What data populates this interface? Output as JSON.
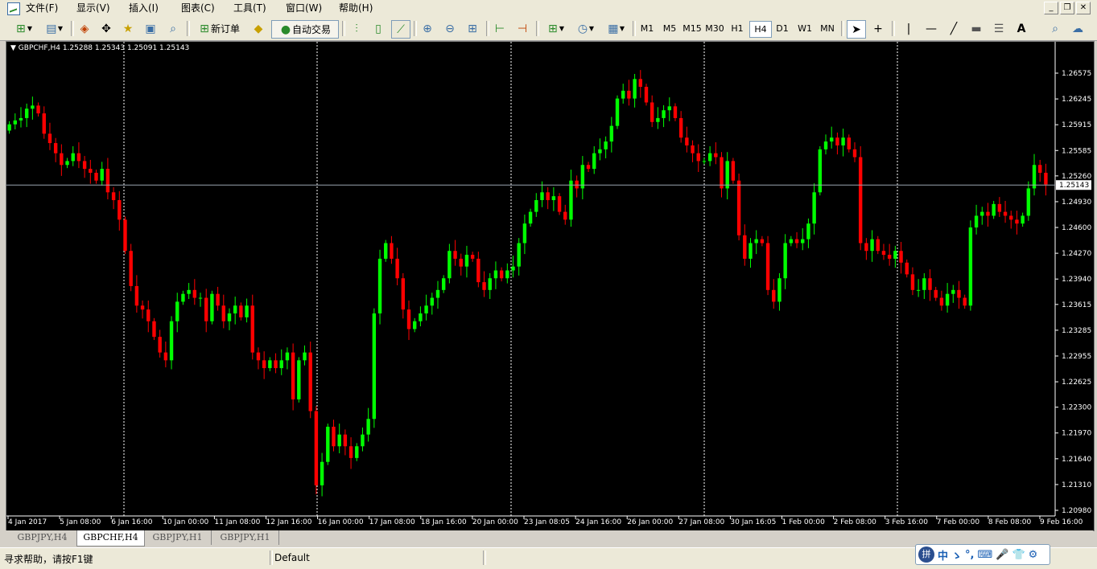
{
  "menu": [
    "文件(F)",
    "显示(V)",
    "插入(I)",
    "图表(C)",
    "工具(T)",
    "窗口(W)",
    "帮助(H)"
  ],
  "window_controls": [
    "_",
    "❐",
    "✕"
  ],
  "toolbar": {
    "new_order_label": "新订单",
    "auto_trade_label": "自动交易",
    "timeframes": [
      "M1",
      "M5",
      "M15",
      "M30",
      "H1",
      "H4",
      "D1",
      "W1",
      "MN"
    ],
    "active_timeframe": "H4",
    "crosshair_label": "+",
    "text_label": "A",
    "line_label": "|"
  },
  "chart": {
    "header": "GBPCHF,H4  1.25288 1.25343 1.25091 1.25143",
    "current_price": "1.25143",
    "bull_color": "#00ff00",
    "bear_color": "#ff0000",
    "grid_color": "#ffffff",
    "price_line_color": "#9aa3b0"
  },
  "chart_data": {
    "type": "candlestick",
    "symbol": "GBPCHF",
    "timeframe": "H4",
    "ylim": [
      1.2098,
      1.2675
    ],
    "y_ticks": [
      "1.26575",
      "1.26245",
      "1.25915",
      "1.25585",
      "1.25260",
      "1.24930",
      "1.24600",
      "1.24270",
      "1.23940",
      "1.23615",
      "1.23285",
      "1.22955",
      "1.22625",
      "1.22300",
      "1.21970",
      "1.21640",
      "1.21310",
      "1.20980"
    ],
    "x_ticks": [
      "4 Jan 2017",
      "5 Jan 08:00",
      "6 Jan 16:00",
      "10 Jan 00:00",
      "11 Jan 08:00",
      "12 Jan 16:00",
      "16 Jan 00:00",
      "17 Jan 08:00",
      "18 Jan 16:00",
      "20 Jan 00:00",
      "23 Jan 08:05",
      "24 Jan 16:00",
      "26 Jan 00:00",
      "27 Jan 08:00",
      "30 Jan 16:05",
      "1 Feb 00:00",
      "2 Feb 08:00",
      "3 Feb 16:00",
      "7 Feb 00:00",
      "8 Feb 08:00",
      "9 Feb 16:00"
    ],
    "closes": [
      1.2592,
      1.2597,
      1.26,
      1.2612,
      1.2616,
      1.2606,
      1.258,
      1.2568,
      1.2555,
      1.254,
      1.2545,
      1.2555,
      1.2545,
      1.2535,
      1.253,
      1.252,
      1.2535,
      1.2505,
      1.2495,
      1.247,
      1.243,
      1.2385,
      1.236,
      1.2355,
      1.234,
      1.232,
      1.23,
      1.229,
      1.234,
      1.2365,
      1.2375,
      1.238,
      1.237,
      1.237,
      1.234,
      1.2375,
      1.236,
      1.234,
      1.235,
      1.236,
      1.2345,
      1.236,
      1.23,
      1.229,
      1.228,
      1.229,
      1.228,
      1.229,
      1.23,
      1.224,
      1.229,
      1.23,
      1.2225,
      1.213,
      1.216,
      1.2205,
      1.218,
      1.2195,
      1.218,
      1.2165,
      1.218,
      1.2195,
      1.2215,
      1.235,
      1.242,
      1.244,
      1.242,
      1.2395,
      1.2355,
      1.233,
      1.234,
      1.235,
      1.236,
      1.237,
      1.238,
      1.2395,
      1.243,
      1.242,
      1.241,
      1.2425,
      1.242,
      1.239,
      1.238,
      1.2395,
      1.2405,
      1.2395,
      1.2405,
      1.241,
      1.244,
      1.2465,
      1.248,
      1.2495,
      1.2505,
      1.2495,
      1.25,
      1.248,
      1.247,
      1.252,
      1.251,
      1.254,
      1.2535,
      1.2555,
      1.256,
      1.257,
      1.259,
      1.2625,
      1.2635,
      1.2625,
      1.265,
      1.264,
      1.262,
      1.2595,
      1.26,
      1.261,
      1.2615,
      1.26,
      1.2575,
      1.2565,
      1.2555,
      1.2545,
      1.2545,
      1.2555,
      1.255,
      1.251,
      1.2545,
      1.252,
      1.245,
      1.242,
      1.244,
      1.2445,
      1.244,
      1.238,
      1.2365,
      1.2395,
      1.244,
      1.2445,
      1.244,
      1.2445,
      1.2465,
      1.2505,
      1.256,
      1.257,
      1.2575,
      1.2565,
      1.2575,
      1.256,
      1.255,
      1.244,
      1.243,
      1.2445,
      1.243,
      1.2425,
      1.242,
      1.243,
      1.2415,
      1.24,
      1.238,
      1.238,
      1.2395,
      1.238,
      1.237,
      1.236,
      1.2375,
      1.238,
      1.237,
      1.236,
      1.246,
      1.2475,
      1.248,
      1.2475,
      1.249,
      1.248,
      1.2475,
      1.247,
      1.2465,
      1.2475,
      1.251,
      1.254,
      1.253,
      1.2515
    ]
  },
  "tabs": [
    "GBPJPY,H4",
    "GBPCHF,H4",
    "GBPJPY,H1",
    "GBPJPY,H1"
  ],
  "active_tab": "GBPCHF,H4",
  "status": {
    "help": "寻求帮助，请按F1键",
    "profile": "Default"
  },
  "ime": {
    "logo": "拼",
    "chars": [
      "中",
      "ゝ",
      "°,",
      "⌨",
      "🎤",
      "👕",
      "⚙"
    ]
  }
}
